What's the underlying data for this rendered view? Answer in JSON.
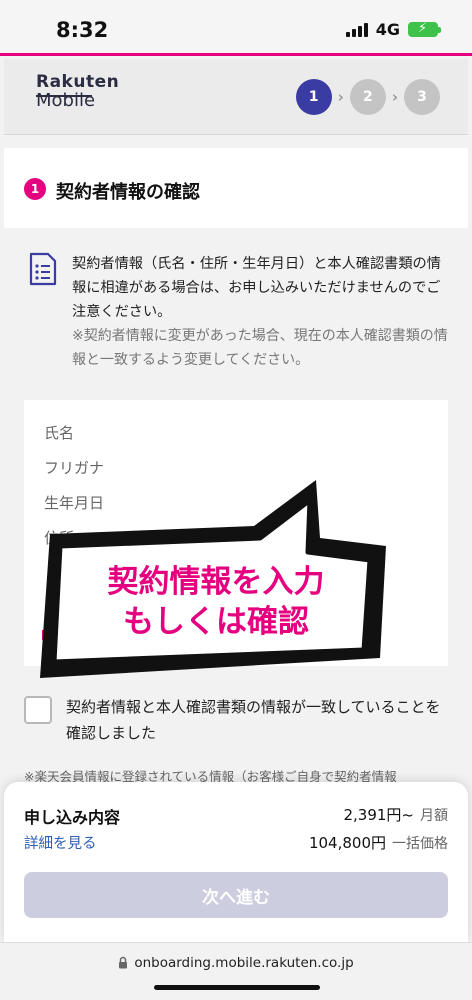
{
  "status_bar": {
    "time": "8:32",
    "network": "4G"
  },
  "header": {
    "logo_top": "Rakuten",
    "logo_bottom": "Mobile",
    "steps": [
      "1",
      "2",
      "3"
    ],
    "active_step": 1
  },
  "section": {
    "number": "1",
    "title": "契約者情報の確認",
    "notice": "契約者情報（氏名・住所・生年月日）と本人確認書類の情報に相違がある場合は、お申し込みいただけませんのでご注意ください。",
    "notice_sub": "※契約者情報に変更があった場合、現在の本人確認書類の情報と一致するよう変更してください。"
  },
  "fields": [
    "氏名",
    "フリガナ",
    "生年月日",
    "住所"
  ],
  "callout": {
    "line1": "契約情報を入力",
    "line2": "もしくは確認"
  },
  "confirm_checkbox": {
    "checked": false,
    "label": "契約者情報と本人確認書類の情報が一致していることを確認しました"
  },
  "footnote": "※楽天会員情報に登録されている情報（お客様ご自身で契約者情報",
  "summary": {
    "title": "申し込み内容",
    "details_link": "詳細を見る",
    "monthly_price": "2,391円~",
    "monthly_label": "月額",
    "lump_price": "104,800円",
    "lump_label": "一括価格",
    "next_button": "次へ進む"
  },
  "browser": {
    "url": "onboarding.mobile.rakuten.co.jp"
  },
  "colors": {
    "accent_pink": "#e4007f",
    "step_active": "#3a3ba3",
    "step_inactive": "#c4c4c4",
    "link": "#2f5fb3",
    "button_disabled": "#cdcde0"
  },
  "icons": [
    "signal-icon",
    "battery-icon",
    "document-icon",
    "lock-icon"
  ]
}
